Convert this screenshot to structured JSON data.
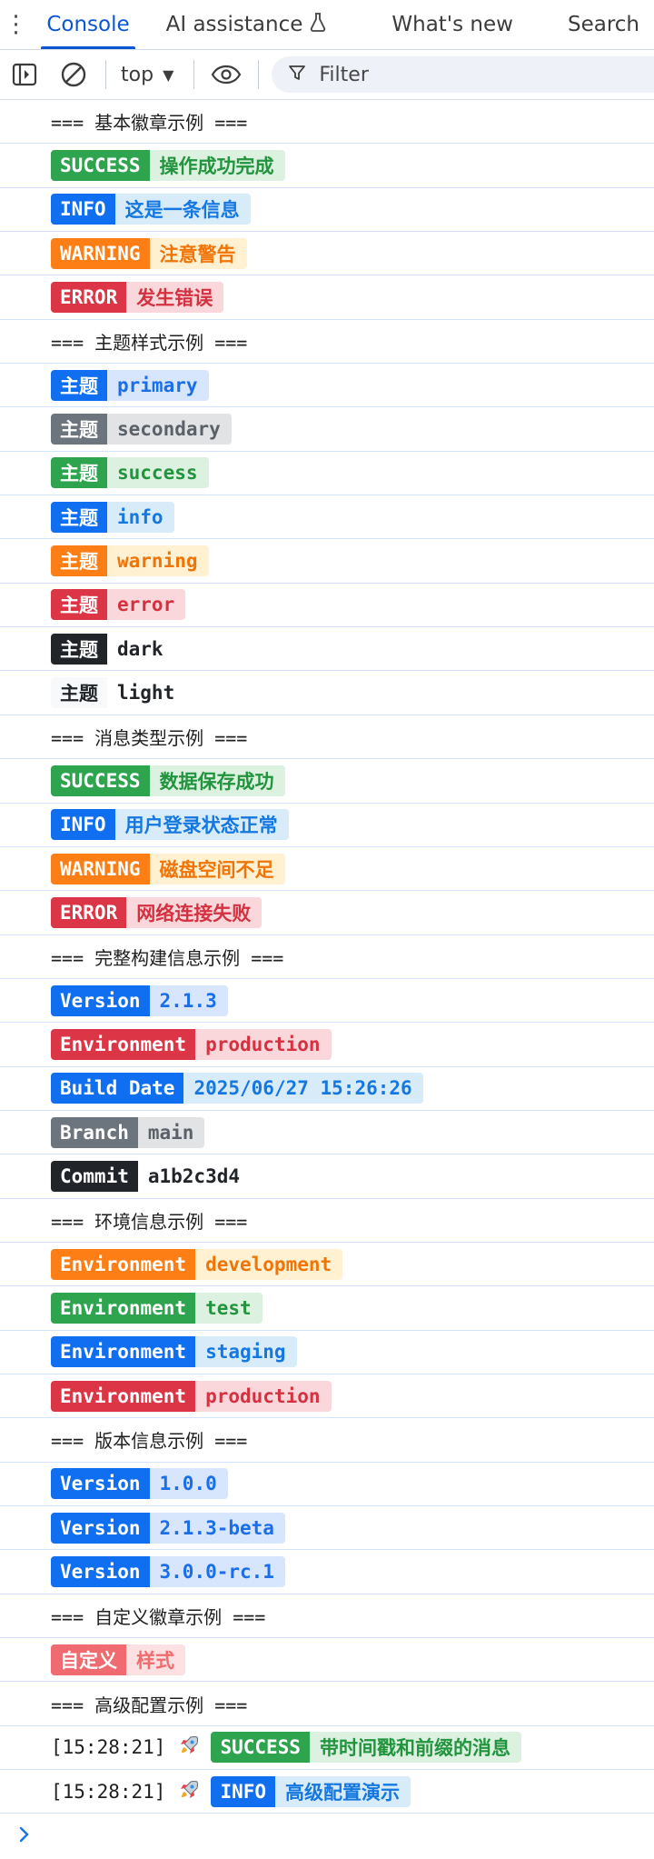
{
  "tabs": {
    "console": "Console",
    "ai": "AI assistance",
    "whats_new": "What's new",
    "search": "Search"
  },
  "toolbar": {
    "context": "top",
    "filter_placeholder": "Filter"
  },
  "rows": [
    {
      "type": "section",
      "text": "=== 基本徽章示例 ==="
    },
    {
      "type": "badge",
      "theme": "success",
      "label": "SUCCESS",
      "value": "操作成功完成"
    },
    {
      "type": "badge",
      "theme": "info",
      "label": "INFO",
      "value": "这是一条信息"
    },
    {
      "type": "badge",
      "theme": "warning",
      "label": "WARNING",
      "value": "注意警告"
    },
    {
      "type": "badge",
      "theme": "error",
      "label": "ERROR",
      "value": "发生错误"
    },
    {
      "type": "section",
      "text": "=== 主题样式示例 ==="
    },
    {
      "type": "badge",
      "theme": "primary",
      "label": "主题",
      "value": "primary"
    },
    {
      "type": "badge",
      "theme": "secondary",
      "label": "主题",
      "value": "secondary"
    },
    {
      "type": "badge",
      "theme": "success",
      "label": "主题",
      "value": "success"
    },
    {
      "type": "badge",
      "theme": "info",
      "label": "主题",
      "value": "info"
    },
    {
      "type": "badge",
      "theme": "warning",
      "label": "主题",
      "value": "warning"
    },
    {
      "type": "badge",
      "theme": "error",
      "label": "主题",
      "value": "error"
    },
    {
      "type": "badge",
      "theme": "dark",
      "label": "主题",
      "value": "dark"
    },
    {
      "type": "badge",
      "theme": "light",
      "label": "主题",
      "value": "light"
    },
    {
      "type": "section",
      "text": "=== 消息类型示例 ==="
    },
    {
      "type": "badge",
      "theme": "success",
      "label": "SUCCESS",
      "value": "数据保存成功"
    },
    {
      "type": "badge",
      "theme": "info",
      "label": "INFO",
      "value": "用户登录状态正常"
    },
    {
      "type": "badge",
      "theme": "warning",
      "label": "WARNING",
      "value": "磁盘空间不足"
    },
    {
      "type": "badge",
      "theme": "error",
      "label": "ERROR",
      "value": "网络连接失败"
    },
    {
      "type": "section",
      "text": "=== 完整构建信息示例 ==="
    },
    {
      "type": "badge",
      "theme": "primary",
      "label": "Version",
      "value": "2.1.3"
    },
    {
      "type": "badge",
      "theme": "error",
      "label": "Environment",
      "value": "production"
    },
    {
      "type": "badge",
      "theme": "info",
      "label": "Build Date",
      "value": "2025/06/27 15:26:26"
    },
    {
      "type": "badge",
      "theme": "secondary",
      "label": "Branch",
      "value": "main"
    },
    {
      "type": "badge",
      "theme": "dark",
      "label": "Commit",
      "value": "a1b2c3d4"
    },
    {
      "type": "section",
      "text": "=== 环境信息示例 ==="
    },
    {
      "type": "badge",
      "theme": "warning",
      "label": "Environment",
      "value": "development"
    },
    {
      "type": "badge",
      "theme": "success",
      "label": "Environment",
      "value": "test"
    },
    {
      "type": "badge",
      "theme": "info",
      "label": "Environment",
      "value": "staging"
    },
    {
      "type": "badge",
      "theme": "error",
      "label": "Environment",
      "value": "production"
    },
    {
      "type": "section",
      "text": "=== 版本信息示例 ==="
    },
    {
      "type": "badge",
      "theme": "primary",
      "label": "Version",
      "value": "1.0.0"
    },
    {
      "type": "badge",
      "theme": "primary",
      "label": "Version",
      "value": "2.1.3-beta"
    },
    {
      "type": "badge",
      "theme": "primary",
      "label": "Version",
      "value": "3.0.0-rc.1"
    },
    {
      "type": "section",
      "text": "=== 自定义徽章示例 ==="
    },
    {
      "type": "badge",
      "theme": "custom",
      "label": "自定义",
      "value": "样式"
    },
    {
      "type": "section",
      "text": "=== 高级配置示例 ==="
    },
    {
      "type": "badge",
      "theme": "success",
      "prefix": "[15:28:21]",
      "icon": "rocket-icon",
      "label": "SUCCESS",
      "value": "带时间戳和前缀的消息"
    },
    {
      "type": "badge",
      "theme": "info",
      "prefix": "[15:28:21]",
      "icon": "rocket-icon",
      "label": "INFO",
      "value": "高级配置演示"
    }
  ],
  "colors": {
    "accent": "#0b57d0",
    "success": "#2ea44f",
    "info": "#0f6ff0",
    "warning": "#fd7e14",
    "error": "#dc3545",
    "secondary": "#6c757d",
    "dark": "#212529",
    "custom": "#ef6b6f"
  }
}
